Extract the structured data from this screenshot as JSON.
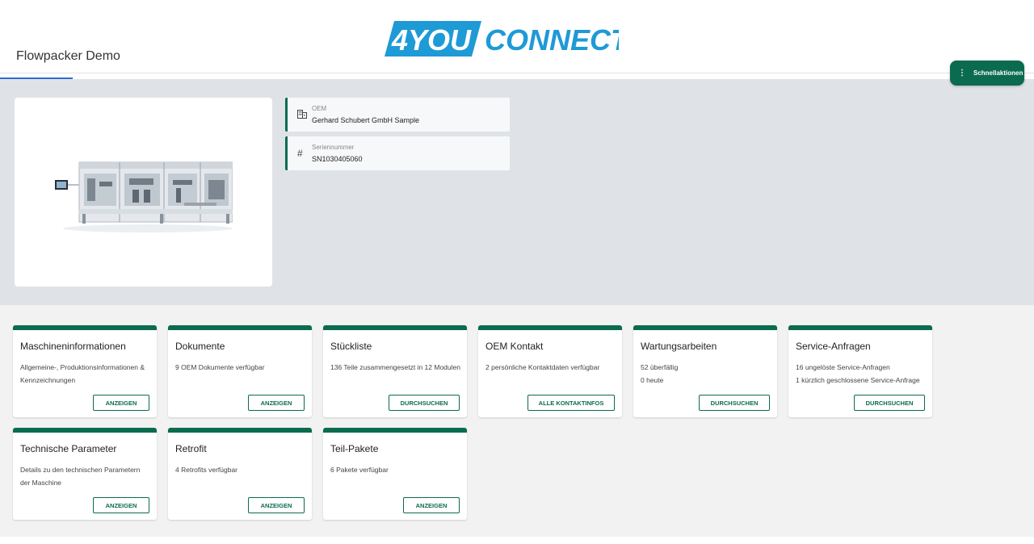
{
  "header": {
    "page_title": "Flowpacker Demo",
    "logo_left": "4YOU",
    "logo_right": "CONNECT",
    "quick_actions_label": "Schnellaktionen"
  },
  "colors": {
    "brand_green": "#0b6b4f",
    "logo_blue": "#1e9ad6",
    "tab_indicator": "#2b6cd3"
  },
  "machine": {
    "image_alt": "machine-image"
  },
  "info": [
    {
      "icon": "building-icon",
      "label": "OEM",
      "value": "Gerhard Schubert GmbH Sample"
    },
    {
      "icon": "hash-icon",
      "label": "Seriennummer",
      "value": "SN1030405060"
    }
  ],
  "tiles": [
    {
      "title": "Maschineninformationen",
      "desc": "Allgemeine-, Produktionsinformationen & Kennzeichnungen",
      "button": "ANZEIGEN"
    },
    {
      "title": "Dokumente",
      "desc": "9 OEM Dokumente verfügbar",
      "button": "ANZEIGEN"
    },
    {
      "title": "Stückliste",
      "desc": "136 Teile zusammengesetzt in 12 Modulen",
      "button": "DURCHSUCHEN"
    },
    {
      "title": "OEM Kontakt",
      "desc": "2 persönliche Kontaktdaten verfügbar",
      "button": "ALLE KONTAKTINFOS"
    },
    {
      "title": "Wartungsarbeiten",
      "desc_line1": "52 überfällig",
      "desc_line2": "0 heute",
      "button": "DURCHSUCHEN"
    },
    {
      "title": "Service-Anfragen",
      "desc_line1": "16 ungelöste Service-Anfragen",
      "desc_line2": "1 kürzlich geschlossene Service-Anfrage",
      "button": "DURCHSUCHEN"
    },
    {
      "title": "Technische Parameter",
      "desc": "Details zu den technischen Parametern der Maschine",
      "button": "ANZEIGEN"
    },
    {
      "title": "Retrofit",
      "desc": "4 Retrofits verfügbar",
      "button": "ANZEIGEN"
    },
    {
      "title": "Teil-Pakete",
      "desc": "6 Pakete verfügbar",
      "button": "ANZEIGEN"
    }
  ]
}
